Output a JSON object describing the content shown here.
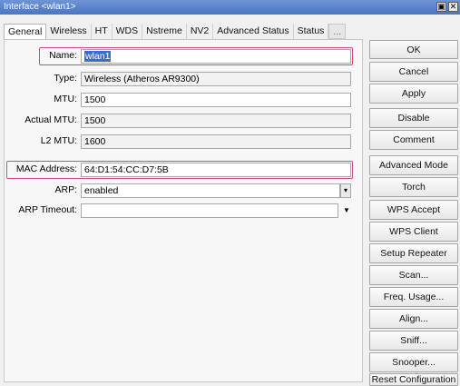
{
  "window": {
    "title": "Interface <wlan1>",
    "restore_glyph": "▣",
    "close_glyph": "✕"
  },
  "tabs": [
    {
      "label": "General"
    },
    {
      "label": "Wireless"
    },
    {
      "label": "HT"
    },
    {
      "label": "WDS"
    },
    {
      "label": "Nstreme"
    },
    {
      "label": "NV2"
    },
    {
      "label": "Advanced Status"
    },
    {
      "label": "Status"
    },
    {
      "label": "..."
    }
  ],
  "fields": {
    "name": {
      "label": "Name:",
      "value": "wlan1"
    },
    "type": {
      "label": "Type:",
      "value": "Wireless (Atheros AR9300)"
    },
    "mtu": {
      "label": "MTU:",
      "value": "1500"
    },
    "actual_mtu": {
      "label": "Actual MTU:",
      "value": "1500"
    },
    "l2_mtu": {
      "label": "L2 MTU:",
      "value": "1600"
    },
    "mac_address": {
      "label": "MAC Address:",
      "value": "64:D1:54:CC:D7:5B"
    },
    "arp": {
      "label": "ARP:",
      "value": "enabled",
      "dropdown_glyph": "▾"
    },
    "arp_timeout": {
      "label": "ARP Timeout:",
      "value": "",
      "dropdown_glyph": "▼"
    }
  },
  "buttons": {
    "ok": "OK",
    "cancel": "Cancel",
    "apply": "Apply",
    "disable": "Disable",
    "comment": "Comment",
    "advanced_mode": "Advanced Mode",
    "torch": "Torch",
    "wps_accept": "WPS Accept",
    "wps_client": "WPS Client",
    "setup_repeater": "Setup Repeater",
    "scan": "Scan...",
    "freq_usage": "Freq. Usage...",
    "align": "Align...",
    "sniff": "Sniff...",
    "snooper": "Snooper...",
    "reset_configuration": "Reset Configuration"
  },
  "colors": {
    "highlight": "#d6478a",
    "titlebar": "#4a74c4",
    "selection": "#3b6bd6"
  }
}
